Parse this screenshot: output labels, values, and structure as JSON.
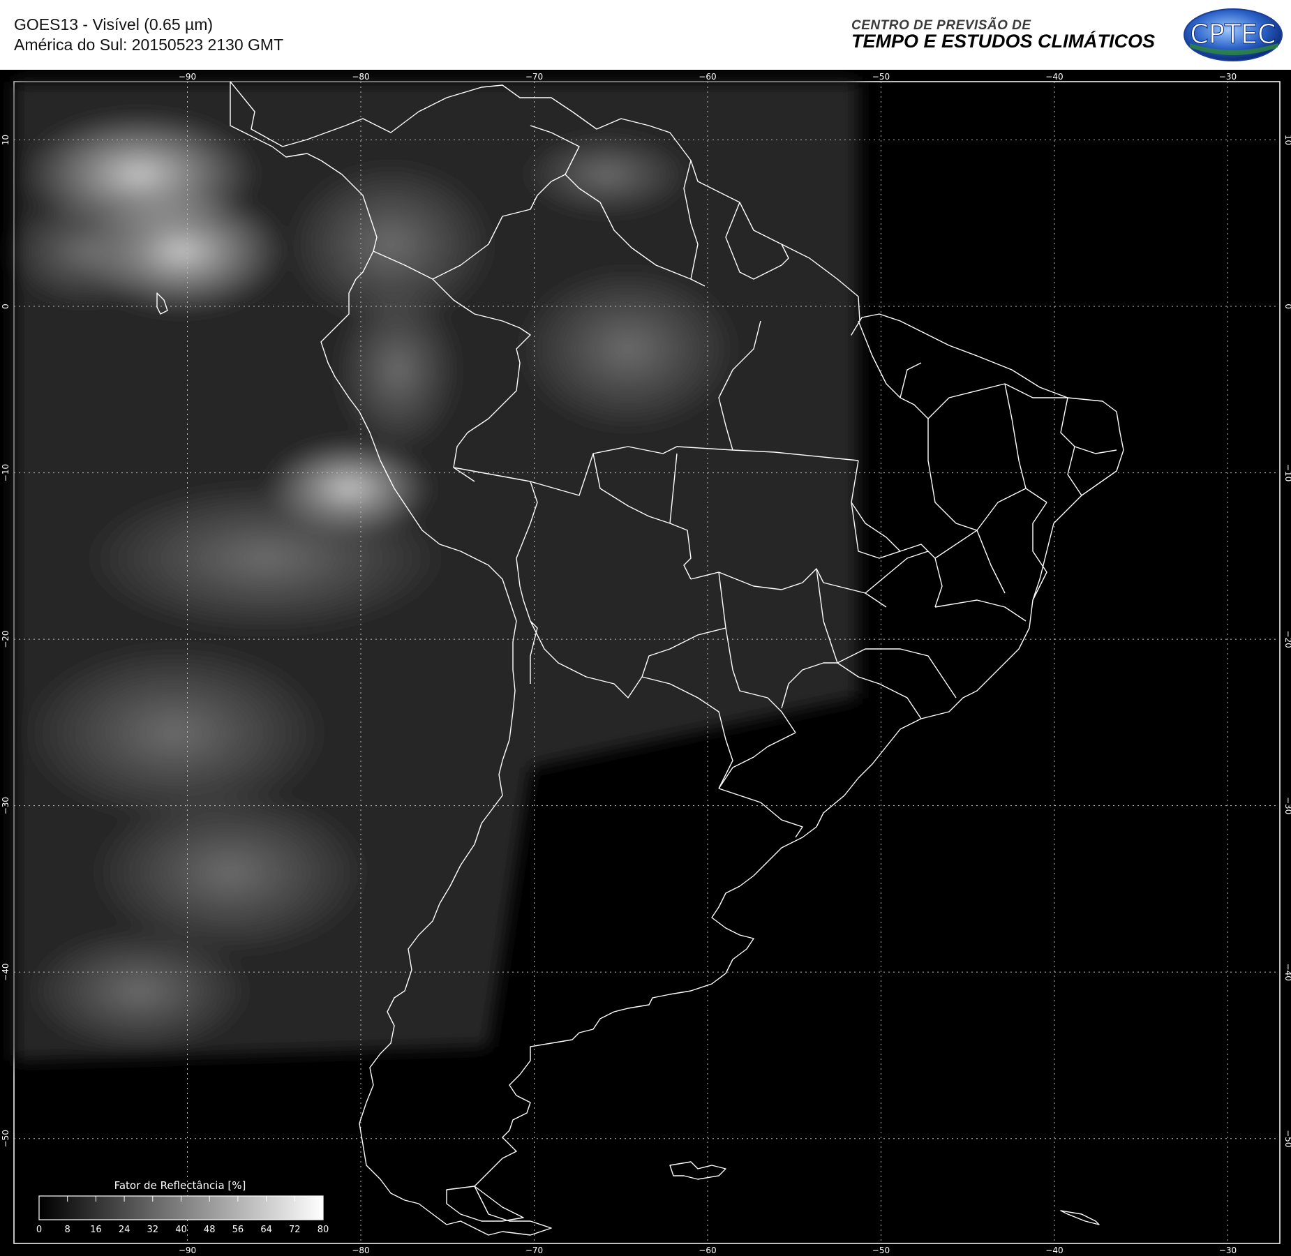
{
  "header": {
    "title_line1": "GOES13 - Visível (0.65 µm)",
    "title_line2": "América do Sul: 20150523 2130 GMT",
    "org_line1": "CENTRO DE PREVISÃO DE",
    "org_line2": "TEMPO E ESTUDOS CLIMÁTICOS",
    "logo_text": "CPTEC"
  },
  "map": {
    "lon_range": [
      -100,
      -27
    ],
    "lat_range": [
      13.5,
      -56.3
    ],
    "lon_ticks": [
      -90,
      -80,
      -70,
      -60,
      -50,
      -40,
      -30
    ],
    "lat_ticks": [
      10,
      0,
      -10,
      -20,
      -30,
      -40,
      -50
    ],
    "gridlines": true,
    "background_color": "#000000",
    "coastline_color": "#ffffff"
  },
  "colorbar": {
    "title": "Fator de Reflectância [%]",
    "ticks": [
      0,
      8,
      16,
      24,
      32,
      40,
      48,
      56,
      64,
      72,
      80
    ],
    "range": [
      0,
      80
    ]
  }
}
